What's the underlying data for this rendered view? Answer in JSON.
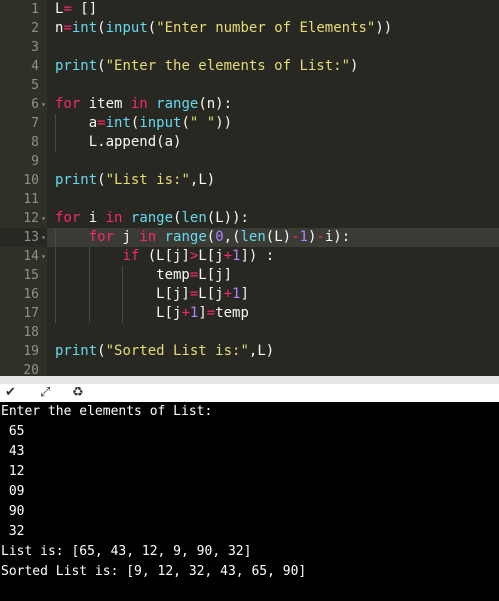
{
  "editor": {
    "lines": [
      {
        "n": "1",
        "fold": false,
        "tokens": [
          [
            "t",
            "L"
          ],
          [
            "k",
            "="
          ],
          [
            "t",
            " []"
          ]
        ]
      },
      {
        "n": "2",
        "fold": false,
        "tokens": [
          [
            "t",
            "n"
          ],
          [
            "k",
            "="
          ],
          [
            "b",
            "int"
          ],
          [
            "t",
            "("
          ],
          [
            "b",
            "input"
          ],
          [
            "t",
            "("
          ],
          [
            "s",
            "\"Enter number of Elements\""
          ],
          [
            "t",
            "))"
          ]
        ]
      },
      {
        "n": "3",
        "fold": false,
        "tokens": []
      },
      {
        "n": "4",
        "fold": false,
        "tokens": [
          [
            "b",
            "print"
          ],
          [
            "t",
            "("
          ],
          [
            "s",
            "\"Enter the elements of List:\""
          ],
          [
            "t",
            ")"
          ]
        ]
      },
      {
        "n": "5",
        "fold": false,
        "tokens": []
      },
      {
        "n": "6",
        "fold": true,
        "tokens": [
          [
            "k",
            "for"
          ],
          [
            "t",
            " item "
          ],
          [
            "k",
            "in"
          ],
          [
            "t",
            " "
          ],
          [
            "b",
            "range"
          ],
          [
            "t",
            "(n):"
          ]
        ]
      },
      {
        "n": "7",
        "fold": false,
        "tokens": [
          [
            "t",
            "    a"
          ],
          [
            "k",
            "="
          ],
          [
            "b",
            "int"
          ],
          [
            "t",
            "("
          ],
          [
            "b",
            "input"
          ],
          [
            "t",
            "("
          ],
          [
            "s",
            "\" \""
          ],
          [
            "t",
            "))"
          ]
        ]
      },
      {
        "n": "8",
        "fold": false,
        "tokens": [
          [
            "t",
            "    L.append(a)"
          ]
        ]
      },
      {
        "n": "9",
        "fold": false,
        "tokens": []
      },
      {
        "n": "10",
        "fold": false,
        "tokens": [
          [
            "b",
            "print"
          ],
          [
            "t",
            "("
          ],
          [
            "s",
            "\"List is:\""
          ],
          [
            "t",
            ",L)"
          ]
        ]
      },
      {
        "n": "11",
        "fold": false,
        "tokens": []
      },
      {
        "n": "12",
        "fold": true,
        "tokens": [
          [
            "k",
            "for"
          ],
          [
            "t",
            " i "
          ],
          [
            "k",
            "in"
          ],
          [
            "t",
            " "
          ],
          [
            "b",
            "range"
          ],
          [
            "t",
            "("
          ],
          [
            "b",
            "len"
          ],
          [
            "t",
            "(L)):"
          ]
        ]
      },
      {
        "n": "13",
        "fold": true,
        "tokens": [
          [
            "t",
            "    "
          ],
          [
            "k",
            "for"
          ],
          [
            "t",
            " j "
          ],
          [
            "k",
            "in"
          ],
          [
            "t",
            " "
          ],
          [
            "b",
            "range"
          ],
          [
            "t",
            "("
          ],
          [
            "n",
            "0"
          ],
          [
            "t",
            ",("
          ],
          [
            "b",
            "len"
          ],
          [
            "t",
            "(L)"
          ],
          [
            "k",
            "-"
          ],
          [
            "n",
            "1"
          ],
          [
            "t",
            ")"
          ],
          [
            "k",
            "-"
          ],
          [
            "t",
            "i):"
          ]
        ]
      },
      {
        "n": "14",
        "fold": true,
        "tokens": [
          [
            "t",
            "        "
          ],
          [
            "k",
            "if"
          ],
          [
            "t",
            " (L[j]"
          ],
          [
            "k",
            ">"
          ],
          [
            "t",
            "L[j"
          ],
          [
            "k",
            "+"
          ],
          [
            "n",
            "1"
          ],
          [
            "t",
            "]) :"
          ]
        ]
      },
      {
        "n": "15",
        "fold": false,
        "tokens": [
          [
            "t",
            "            temp"
          ],
          [
            "k",
            "="
          ],
          [
            "t",
            "L[j]"
          ]
        ]
      },
      {
        "n": "16",
        "fold": false,
        "tokens": [
          [
            "t",
            "            L[j]"
          ],
          [
            "k",
            "="
          ],
          [
            "t",
            "L[j"
          ],
          [
            "k",
            "+"
          ],
          [
            "n",
            "1"
          ],
          [
            "t",
            "]"
          ]
        ]
      },
      {
        "n": "17",
        "fold": false,
        "tokens": [
          [
            "t",
            "            L[j"
          ],
          [
            "k",
            "+"
          ],
          [
            "n",
            "1"
          ],
          [
            "t",
            "]"
          ],
          [
            "k",
            "="
          ],
          [
            "t",
            "temp"
          ]
        ]
      },
      {
        "n": "18",
        "fold": false,
        "tokens": []
      },
      {
        "n": "19",
        "fold": false,
        "tokens": [
          [
            "b",
            "print"
          ],
          [
            "t",
            "("
          ],
          [
            "s",
            "\"Sorted List is:\""
          ],
          [
            "t",
            ",L)"
          ]
        ]
      },
      {
        "n": "20",
        "fold": false,
        "tokens": []
      }
    ],
    "active_line": "13"
  },
  "toolbar": {
    "collapse_icon": "chevron-down-icon",
    "expand_icon": "expand-arrows-icon",
    "clear_icon": "clear-console-icon"
  },
  "console": {
    "lines": [
      "Enter the elements of List:",
      " 65",
      " 43",
      " 12",
      " 09",
      " 90",
      " 32",
      "List is: [65, 43, 12, 9, 90, 32]",
      "Sorted List is: [9, 12, 32, 43, 65, 90]"
    ]
  },
  "colors": {
    "editor_bg": "#272822",
    "gutter_bg": "#2f3129",
    "keyword": "#f92672",
    "string": "#e6db74",
    "builtin": "#66d9ef",
    "number": "#ae81ff",
    "console_bg": "#000000"
  }
}
